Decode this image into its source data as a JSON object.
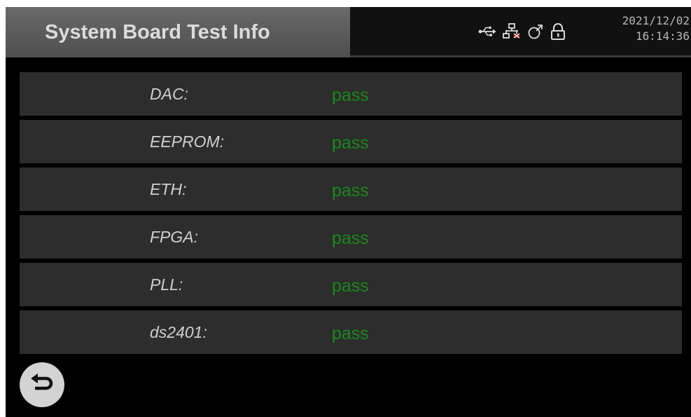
{
  "header": {
    "title": "System Board Test Info",
    "date": "2021/12/02",
    "time": "16:14:36",
    "icons": [
      "usb-icon",
      "network-icon",
      "signal-icon",
      "lock-icon"
    ],
    "network_status_color": "#c02020"
  },
  "tests": [
    {
      "label": "DAC:",
      "result": "pass"
    },
    {
      "label": "EEPROM:",
      "result": "pass"
    },
    {
      "label": "ETH:",
      "result": "pass"
    },
    {
      "label": "FPGA:",
      "result": "pass"
    },
    {
      "label": "PLL:",
      "result": "pass"
    },
    {
      "label": "ds2401:",
      "result": "pass"
    }
  ],
  "colors": {
    "pass": "#1b8a1b",
    "row_background": "#2d2d2d",
    "background": "#000000"
  },
  "footer": {
    "back_icon": "return-icon"
  }
}
